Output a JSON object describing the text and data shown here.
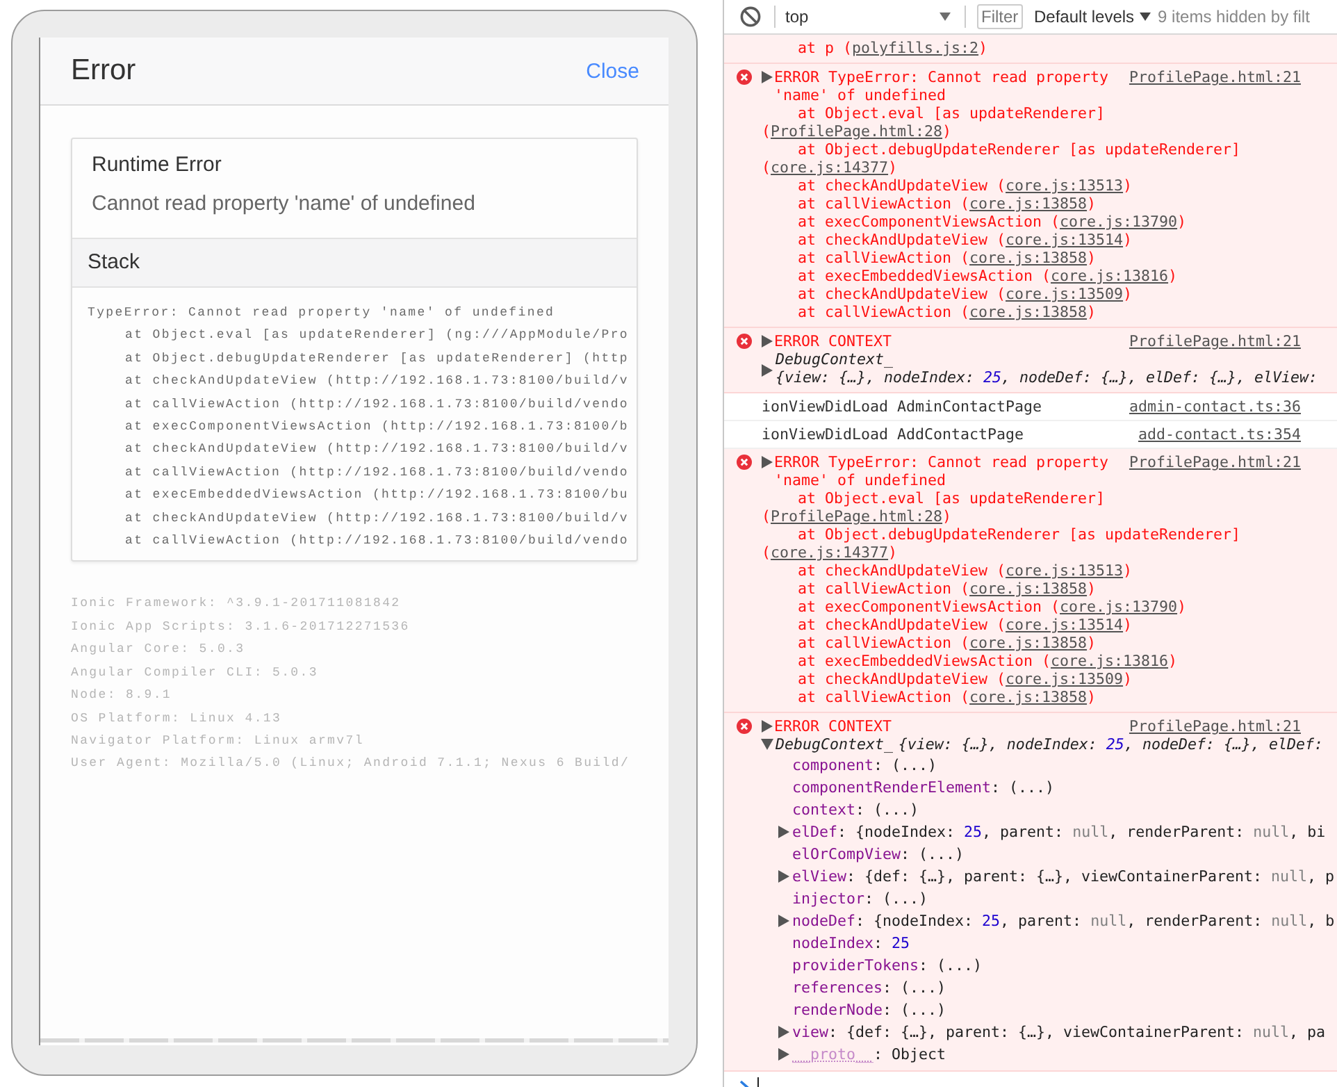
{
  "device": {
    "header": {
      "title": "Error",
      "close": "Close"
    },
    "error": {
      "title": "Runtime Error",
      "message": "Cannot read property 'name' of undefined",
      "stack_label": "Stack",
      "stack_message": "TypeError: Cannot read property 'name' of undefined",
      "stack_frames": [
        "at Object.eval [as updateRenderer] (ng:///AppModule/Pro",
        "at Object.debugUpdateRenderer [as updateRenderer] (http",
        "at checkAndUpdateView (http://192.168.1.73:8100/build/v",
        "at callViewAction (http://192.168.1.73:8100/build/vendo",
        "at execComponentViewsAction (http://192.168.1.73:8100/b",
        "at checkAndUpdateView (http://192.168.1.73:8100/build/v",
        "at callViewAction (http://192.168.1.73:8100/build/vendo",
        "at execEmbeddedViewsAction (http://192.168.1.73:8100/bu",
        "at checkAndUpdateView (http://192.168.1.73:8100/build/v",
        "at callViewAction (http://192.168.1.73:8100/build/vendo"
      ]
    },
    "environment": [
      "Ionic Framework: ^3.9.1-201711081842",
      "Ionic App Scripts: 3.1.6-201712271536",
      "Angular Core: 5.0.3",
      "Angular Compiler CLI: 5.0.3",
      "Node: 8.9.1",
      "OS Platform: Linux 4.13",
      "Navigator Platform: Linux armv7l",
      "User Agent: Mozilla/5.0 (Linux; Android 7.1.1; Nexus 6 Build/"
    ]
  },
  "devtools": {
    "toolbar": {
      "context": "top",
      "filter_placeholder": "Filter",
      "levels": "Default levels",
      "hidden_count": "9 items hidden by filt"
    },
    "messages": [
      {
        "kind": "trace_tail",
        "frames": [
          {
            "text": "at p (",
            "link": "polyfills.js:2",
            "end": ")"
          }
        ]
      },
      {
        "kind": "error",
        "text": "ERROR TypeError: Cannot read property 'name' of undefined",
        "source": "ProfilePage.html:21",
        "expanded": false,
        "frames": [
          {
            "text": "at Object.eval [as updateRenderer] (",
            "link": "ProfilePage.html:28",
            "end": ")"
          },
          {
            "text": "at Object.debugUpdateRenderer [as updateRenderer] (",
            "link": "core.js:14377",
            "end": ")"
          },
          {
            "text": "at checkAndUpdateView (",
            "link": "core.js:13513",
            "end": ")"
          },
          {
            "text": "at callViewAction (",
            "link": "core.js:13858",
            "end": ")"
          },
          {
            "text": "at execComponentViewsAction (",
            "link": "core.js:13790",
            "end": ")"
          },
          {
            "text": "at checkAndUpdateView (",
            "link": "core.js:13514",
            "end": ")"
          },
          {
            "text": "at callViewAction (",
            "link": "core.js:13858",
            "end": ")"
          },
          {
            "text": "at execEmbeddedViewsAction (",
            "link": "core.js:13816",
            "end": ")"
          },
          {
            "text": "at checkAndUpdateView (",
            "link": "core.js:13509",
            "end": ")"
          },
          {
            "text": "at callViewAction (",
            "link": "core.js:13858",
            "end": ")"
          }
        ]
      },
      {
        "kind": "context",
        "text": "ERROR CONTEXT",
        "source": "ProfilePage.html:21",
        "expanded": false,
        "object": {
          "label": "DebugContext_",
          "expanded": false,
          "preview": [
            {
              "text": "{view: {…}, nodeIndex: ",
              "kind": "plain"
            },
            {
              "text": "25",
              "kind": "number"
            },
            {
              "text": ", nodeDef: {…}, elDef: {…}, elView:",
              "kind": "plain"
            }
          ]
        }
      },
      {
        "kind": "log",
        "text": "ionViewDidLoad AdminContactPage",
        "source": "admin-contact.ts:36"
      },
      {
        "kind": "log",
        "text": "ionViewDidLoad AddContactPage",
        "source": "add-contact.ts:354"
      },
      {
        "kind": "error",
        "text": "ERROR TypeError: Cannot read property 'name' of undefined",
        "source": "ProfilePage.html:21",
        "expanded": false,
        "frames": [
          {
            "text": "at Object.eval [as updateRenderer] (",
            "link": "ProfilePage.html:28",
            "end": ")"
          },
          {
            "text": "at Object.debugUpdateRenderer [as updateRenderer] (",
            "link": "core.js:14377",
            "end": ")"
          },
          {
            "text": "at checkAndUpdateView (",
            "link": "core.js:13513",
            "end": ")"
          },
          {
            "text": "at callViewAction (",
            "link": "core.js:13858",
            "end": ")"
          },
          {
            "text": "at execComponentViewsAction (",
            "link": "core.js:13790",
            "end": ")"
          },
          {
            "text": "at checkAndUpdateView (",
            "link": "core.js:13514",
            "end": ")"
          },
          {
            "text": "at callViewAction (",
            "link": "core.js:13858",
            "end": ")"
          },
          {
            "text": "at execEmbeddedViewsAction (",
            "link": "core.js:13816",
            "end": ")"
          },
          {
            "text": "at checkAndUpdateView (",
            "link": "core.js:13509",
            "end": ")"
          },
          {
            "text": "at callViewAction (",
            "link": "core.js:13858",
            "end": ")"
          }
        ]
      },
      {
        "kind": "context",
        "text": "ERROR CONTEXT",
        "source": "ProfilePage.html:21",
        "expanded": false,
        "object": {
          "label": "DebugContext_",
          "expanded": true,
          "preview": [
            {
              "text": "{view: {…}, nodeIndex: ",
              "kind": "plain"
            },
            {
              "text": "25",
              "kind": "number"
            },
            {
              "text": ", nodeDef: {…}, elDef:",
              "kind": "plain"
            }
          ],
          "properties": [
            {
              "key": "component",
              "expandable": false,
              "internal": false,
              "value": [
                {
                  "text": ": (...)",
                  "kind": "plain"
                }
              ]
            },
            {
              "key": "componentRenderElement",
              "expandable": false,
              "internal": false,
              "value": [
                {
                  "text": ": (...)",
                  "kind": "plain"
                }
              ]
            },
            {
              "key": "context",
              "expandable": false,
              "internal": false,
              "value": [
                {
                  "text": ": (...)",
                  "kind": "plain"
                }
              ]
            },
            {
              "key": "elDef",
              "expandable": true,
              "internal": false,
              "value": [
                {
                  "text": ": {nodeIndex: ",
                  "kind": "plain"
                },
                {
                  "text": "25",
                  "kind": "number"
                },
                {
                  "text": ", parent: ",
                  "kind": "plain"
                },
                {
                  "text": "null",
                  "kind": "null"
                },
                {
                  "text": ", renderParent: ",
                  "kind": "plain"
                },
                {
                  "text": "null",
                  "kind": "null"
                },
                {
                  "text": ", bi",
                  "kind": "plain"
                }
              ]
            },
            {
              "key": "elOrCompView",
              "expandable": false,
              "internal": false,
              "value": [
                {
                  "text": ": (...)",
                  "kind": "plain"
                }
              ]
            },
            {
              "key": "elView",
              "expandable": true,
              "internal": false,
              "value": [
                {
                  "text": ": {def: {…}, parent: {…}, viewContainerParent: ",
                  "kind": "plain"
                },
                {
                  "text": "null",
                  "kind": "null"
                },
                {
                  "text": ", p",
                  "kind": "plain"
                }
              ]
            },
            {
              "key": "injector",
              "expandable": false,
              "internal": false,
              "value": [
                {
                  "text": ": (...)",
                  "kind": "plain"
                }
              ]
            },
            {
              "key": "nodeDef",
              "expandable": true,
              "internal": false,
              "value": [
                {
                  "text": ": {nodeIndex: ",
                  "kind": "plain"
                },
                {
                  "text": "25",
                  "kind": "number"
                },
                {
                  "text": ", parent: ",
                  "kind": "plain"
                },
                {
                  "text": "null",
                  "kind": "null"
                },
                {
                  "text": ", renderParent: ",
                  "kind": "plain"
                },
                {
                  "text": "null",
                  "kind": "null"
                },
                {
                  "text": ", b",
                  "kind": "plain"
                }
              ]
            },
            {
              "key": "nodeIndex",
              "expandable": false,
              "internal": false,
              "value": [
                {
                  "text": ": ",
                  "kind": "plain"
                },
                {
                  "text": "25",
                  "kind": "number"
                }
              ]
            },
            {
              "key": "providerTokens",
              "expandable": false,
              "internal": false,
              "value": [
                {
                  "text": ": (...)",
                  "kind": "plain"
                }
              ]
            },
            {
              "key": "references",
              "expandable": false,
              "internal": false,
              "value": [
                {
                  "text": ": (...)",
                  "kind": "plain"
                }
              ]
            },
            {
              "key": "renderNode",
              "expandable": false,
              "internal": false,
              "value": [
                {
                  "text": ": (...)",
                  "kind": "plain"
                }
              ]
            },
            {
              "key": "view",
              "expandable": true,
              "internal": false,
              "value": [
                {
                  "text": ": {def: {…}, parent: {…}, viewContainerParent: ",
                  "kind": "plain"
                },
                {
                  "text": "null",
                  "kind": "null"
                },
                {
                  "text": ", pa",
                  "kind": "plain"
                }
              ]
            },
            {
              "key": "__proto__",
              "expandable": true,
              "internal": true,
              "value": [
                {
                  "text": ": Object",
                  "kind": "plain"
                }
              ]
            }
          ]
        }
      }
    ]
  }
}
